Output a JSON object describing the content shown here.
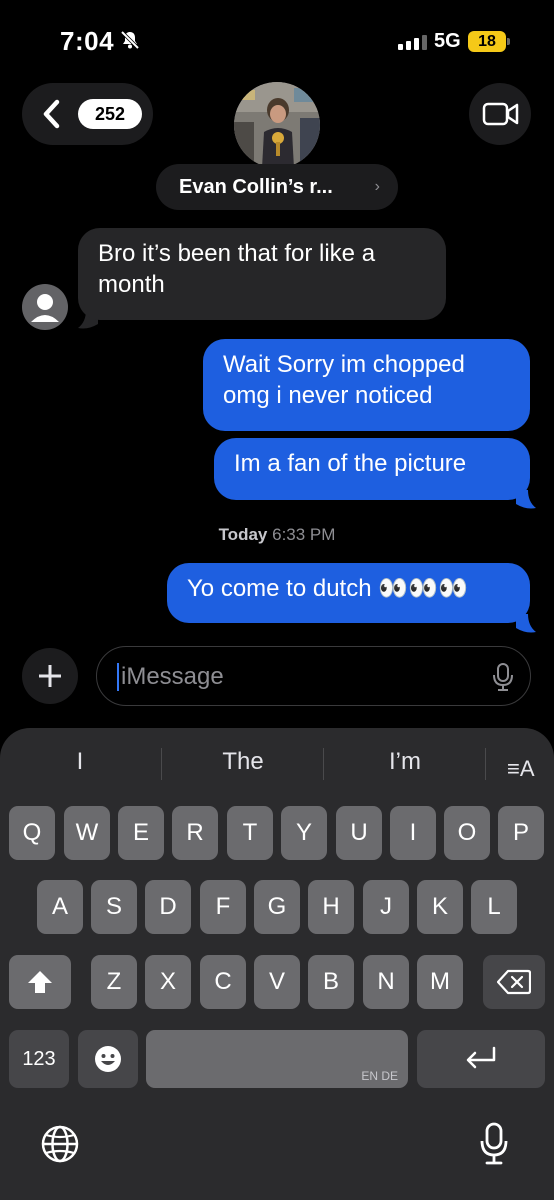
{
  "status_bar": {
    "time": "7:04",
    "network": "5G",
    "battery": "18"
  },
  "header": {
    "back_count": "252",
    "contact_name": "Evan Collin’s r...",
    "contact_chevron": "›"
  },
  "messages": [
    {
      "direction": "incoming",
      "lines": [
        "Bro it’s been that for like a",
        "month"
      ]
    },
    {
      "direction": "outgoing",
      "lines": [
        "Wait Sorry im chopped",
        "omg i never noticed"
      ]
    },
    {
      "direction": "outgoing",
      "lines": [
        "Im a fan of the picture"
      ]
    },
    {
      "direction": "outgoing",
      "lines": [
        "Yo come to dutch 👀👀👀"
      ]
    }
  ],
  "timestamp": {
    "day": "Today",
    "time": "6:33 PM"
  },
  "composer": {
    "placeholder": "iMessage"
  },
  "keyboard": {
    "predictions": [
      "I",
      "The",
      "I’m"
    ],
    "row1": [
      "Q",
      "W",
      "E",
      "R",
      "T",
      "Y",
      "U",
      "I",
      "O",
      "P"
    ],
    "row2": [
      "A",
      "S",
      "D",
      "F",
      "G",
      "H",
      "J",
      "K",
      "L"
    ],
    "row3": [
      "Z",
      "X",
      "C",
      "V",
      "B",
      "N",
      "M"
    ],
    "numbers_key": "123",
    "space_language": "EN DE",
    "format_icon": "≡A"
  },
  "colors": {
    "outgoing_bubble": "#1e5fe0",
    "incoming_bubble": "#262628",
    "background": "#000000"
  },
  "icons": [
    "bell-slash-icon",
    "signal-icon",
    "battery-icon",
    "back-chevron-icon",
    "video-camera-icon",
    "person-icon",
    "plus-icon",
    "microphone-icon",
    "shift-icon",
    "delete-icon",
    "emoji-icon",
    "return-icon",
    "globe-icon"
  ]
}
